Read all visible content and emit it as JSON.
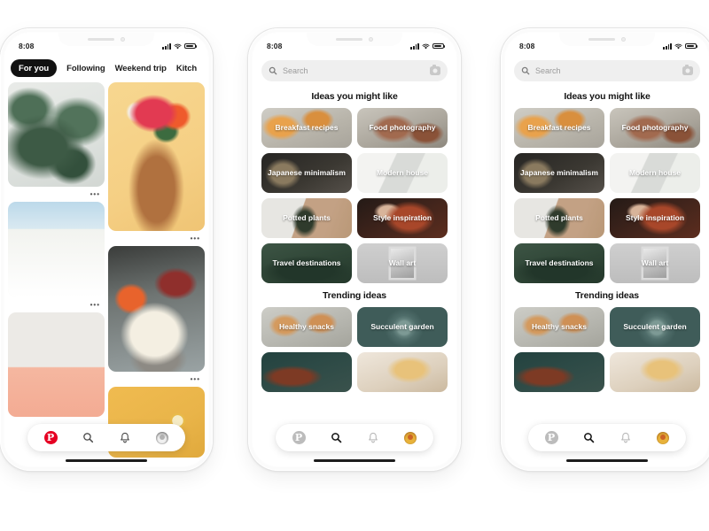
{
  "meta": {
    "app_name": "Pinterest",
    "screen_count": 3
  },
  "status_bar": {
    "time": "8:08",
    "signal_icon": "signal-bars-icon",
    "wifi_icon": "wifi-icon",
    "battery_icon": "battery-full-icon"
  },
  "phone1": {
    "label": "home-feed-screen",
    "tabs": [
      {
        "label": "For you",
        "active": true
      },
      {
        "label": "Following",
        "active": false
      },
      {
        "label": "Weekend trip",
        "active": false
      },
      {
        "label": "Kitch",
        "active": false
      }
    ],
    "pins": [
      {
        "name": "rubber-plant-pin",
        "alt": "Green rubber plant leaves on grey background"
      },
      {
        "name": "white-architecture-pin",
        "alt": "White Mediterranean house under blue sky"
      },
      {
        "name": "pink-bird-pin",
        "alt": "White bird on pink sand minimal photo"
      },
      {
        "name": "flower-crown-portrait-pin",
        "alt": "Smiling woman wearing red flower crown on yellow backdrop"
      },
      {
        "name": "tacos-pin",
        "alt": "Plate of tacos with salsa on wooden table"
      },
      {
        "name": "lemon-pin",
        "alt": "Sliced lemon on yellow background"
      }
    ],
    "overflow_label": "•••"
  },
  "search_screen": {
    "label": "search-screen",
    "search": {
      "placeholder": "Search",
      "search_icon": "search-icon",
      "camera_icon": "camera-lens-icon"
    },
    "sections": [
      {
        "title": "Ideas you might like",
        "tiles": [
          {
            "label": "Breakfast recipes",
            "style": "t-breakfast"
          },
          {
            "label": "Food photography",
            "style": "t-food"
          },
          {
            "label": "Japanese minimalism",
            "style": "t-japanese"
          },
          {
            "label": "Modern house",
            "style": "t-modern"
          },
          {
            "label": "Potted plants",
            "style": "t-potted"
          },
          {
            "label": "Style inspiration",
            "style": "t-style"
          },
          {
            "label": "Travel destinations",
            "style": "t-travel"
          },
          {
            "label": "Wall art",
            "style": "t-wall"
          }
        ]
      },
      {
        "title": "Trending ideas",
        "tiles": [
          {
            "label": "Healthy snacks",
            "style": "t-healthy"
          },
          {
            "label": "Succulent garden",
            "style": "t-succulent"
          },
          {
            "label": "",
            "style": "t-meat"
          },
          {
            "label": "",
            "style": "t-drink"
          }
        ]
      }
    ]
  },
  "bottom_nav": {
    "items": [
      {
        "name": "home-pinterest-logo",
        "icon": "pinterest-logo-icon",
        "glyph": "P"
      },
      {
        "name": "search-nav",
        "icon": "search-icon"
      },
      {
        "name": "notifications-nav",
        "icon": "bell-icon"
      },
      {
        "name": "profile-nav",
        "icon": "avatar-icon"
      }
    ],
    "phone1_active": "home-pinterest-logo",
    "phone23_active": "search-nav"
  },
  "colors": {
    "brand_red": "#e60023",
    "active_tab_bg": "#111111",
    "search_bar_bg": "#efefef",
    "page_bg": "#ffffff",
    "text_primary": "#141414",
    "text_muted": "#9b9b9b"
  }
}
